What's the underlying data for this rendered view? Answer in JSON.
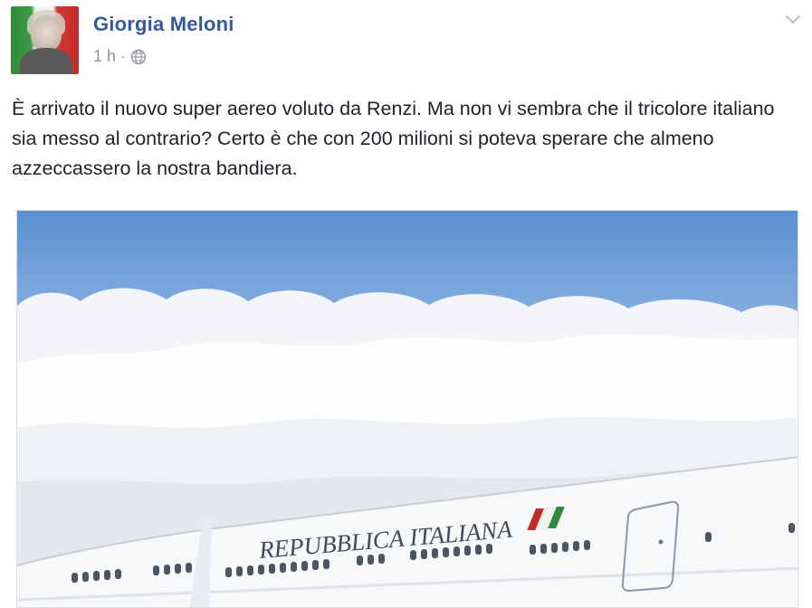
{
  "post": {
    "author": "Giorgia Meloni",
    "time": "1 h",
    "separator": "·",
    "privacy_icon": "globe-icon",
    "text": "È arrivato il nuovo super aereo voluto da Renzi. Ma non vi sembra che il tricolore italiano sia messo al contrario? Certo è che con 200 milioni si poteva sperare che almeno azzeccassero la nostra bandiera.",
    "photo": {
      "fuselage_label": "REPUBBLICA ITALIANA"
    }
  },
  "colors": {
    "name_link": "#365899",
    "meta_gray": "#90949c",
    "flag_green": "#2f8a3a",
    "flag_white": "#f2f2ee",
    "flag_red": "#c32a28"
  }
}
